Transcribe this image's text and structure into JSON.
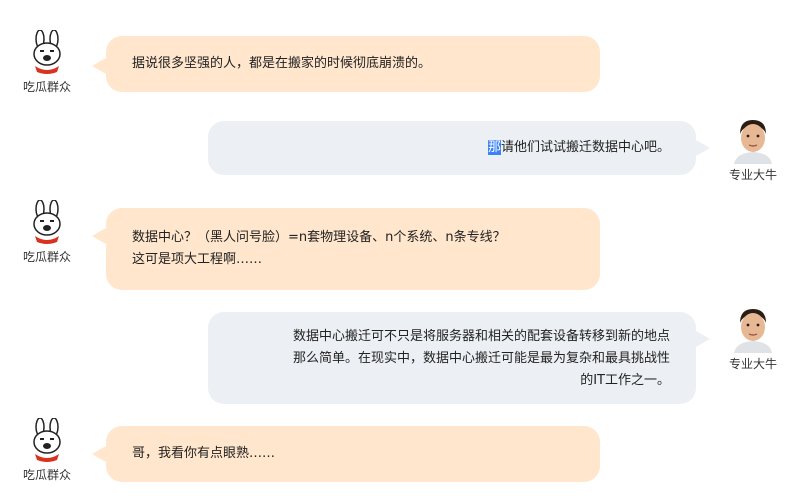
{
  "users": {
    "melon": {
      "name": "吃瓜群众",
      "avatar_icon": "rabbit-icon"
    },
    "expert": {
      "name": "专业大牛",
      "avatar_icon": "man-portrait-icon"
    }
  },
  "messages": [
    {
      "sender": "melon",
      "lines": [
        "据说很多坚强的人，都是在搬家的时候彻底崩溃的。"
      ]
    },
    {
      "sender": "expert",
      "highlight": "那",
      "lines": [
        "请他们试试搬迁数据中心吧。"
      ]
    },
    {
      "sender": "melon",
      "lines": [
        "数据中心？（黑人问号脸）=n套物理设备、n个系统、n条专线？",
        "这可是项大工程啊……"
      ]
    },
    {
      "sender": "expert",
      "lines": [
        "数据中心搬迁可不只是将服务器和相关的配套设备转移到新的地点",
        "那么简单。在现实中，数据中心搬迁可能是最为复杂和最具挑战性",
        "的IT工作之一。"
      ]
    },
    {
      "sender": "melon",
      "lines": [
        "哥，我看你有点眼熟……"
      ]
    }
  ],
  "colors": {
    "left_bubble": "#ffe6cc",
    "right_bubble": "#eceff3",
    "selection": "#3b82f6"
  }
}
